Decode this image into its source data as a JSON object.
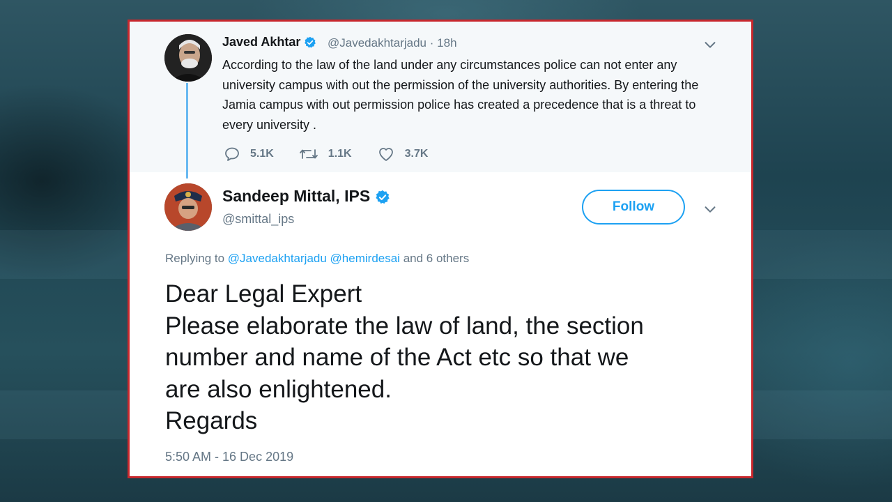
{
  "parent_tweet": {
    "author_name": "Javed Akhtar",
    "handle": "@Javedakhtarjadu",
    "separator": "·",
    "time": "18h",
    "text": "According to the law of the land under any circumstances police can not enter any university campus with out the permission of the university authorities. By entering the Jamia campus with out permission police has  created a precedence that is a threat to every university .",
    "stats": {
      "replies": "5.1K",
      "retweets": "1.1K",
      "likes": "3.7K"
    }
  },
  "reply_tweet": {
    "author_name": "Sandeep Mittal, IPS",
    "handle": "@smittal_ips",
    "follow_label": "Follow",
    "replying_prefix": "Replying to",
    "replying_mention_1": "@Javedakhtarjadu",
    "replying_mention_2": "@hemirdesai",
    "replying_suffix": "and 6 others",
    "lines": [
      "Dear Legal Expert",
      "Please elaborate the law of land, the section",
      "number and name of the Act etc so that we",
      "are also enlightened.",
      "Regards"
    ],
    "timestamp": "5:50 AM - 16 Dec 2019"
  },
  "colors": {
    "accent": "#1da1f2",
    "frame_border": "#c8282d",
    "secondary_text": "#657786",
    "thread_line": "#69b9f1"
  },
  "icons": [
    "verified-badge-icon",
    "chevron-down-icon",
    "reply-icon",
    "retweet-icon",
    "like-icon"
  ]
}
